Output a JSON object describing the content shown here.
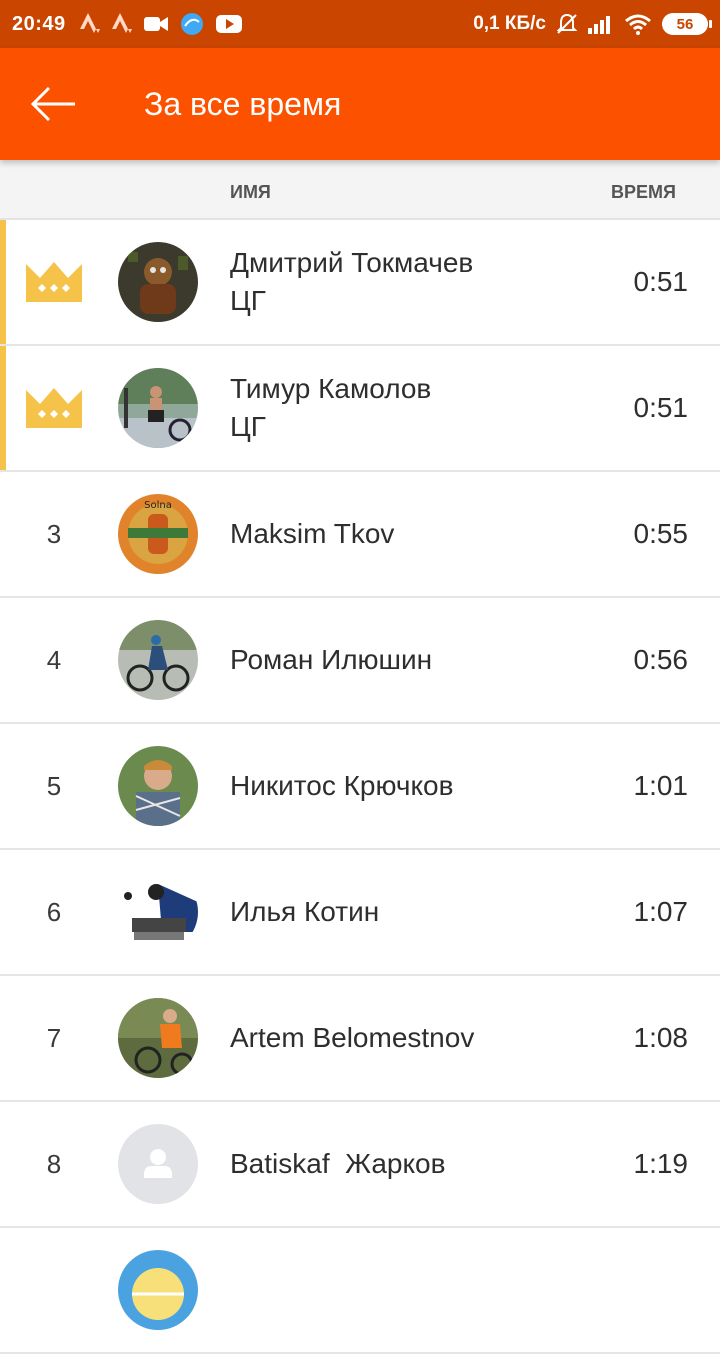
{
  "status_bar": {
    "time": "20:49",
    "network_speed": "0,1 КБ/с",
    "battery": "56"
  },
  "app_bar": {
    "title": "За все время"
  },
  "columns": {
    "name": "ИМЯ",
    "time": "ВРЕМЯ"
  },
  "leaderboard": [
    {
      "rank": "",
      "crown": true,
      "name": "Дмитрий Токмачев",
      "sub": "ЦГ",
      "time": "0:51"
    },
    {
      "rank": "",
      "crown": true,
      "name": "Тимур Камолов",
      "sub": "ЦГ",
      "time": "0:51"
    },
    {
      "rank": "3",
      "crown": false,
      "name": "Maksim Tkov",
      "sub": "",
      "time": "0:55"
    },
    {
      "rank": "4",
      "crown": false,
      "name": "Роман Илюшин",
      "sub": "",
      "time": "0:56"
    },
    {
      "rank": "5",
      "crown": false,
      "name": "Никитос Крючков",
      "sub": "",
      "time": "1:01"
    },
    {
      "rank": "6",
      "crown": false,
      "name": "Илья Котин",
      "sub": "",
      "time": "1:07"
    },
    {
      "rank": "7",
      "crown": false,
      "name": "Artem Belomestnov",
      "sub": "",
      "time": "1:08"
    },
    {
      "rank": "8",
      "crown": false,
      "name": "Batiskaf  Жарков",
      "sub": "",
      "time": "1:19"
    }
  ],
  "colors": {
    "status_bar": "#c94500",
    "app_bar": "#fc5200",
    "crown": "#f5c349"
  }
}
